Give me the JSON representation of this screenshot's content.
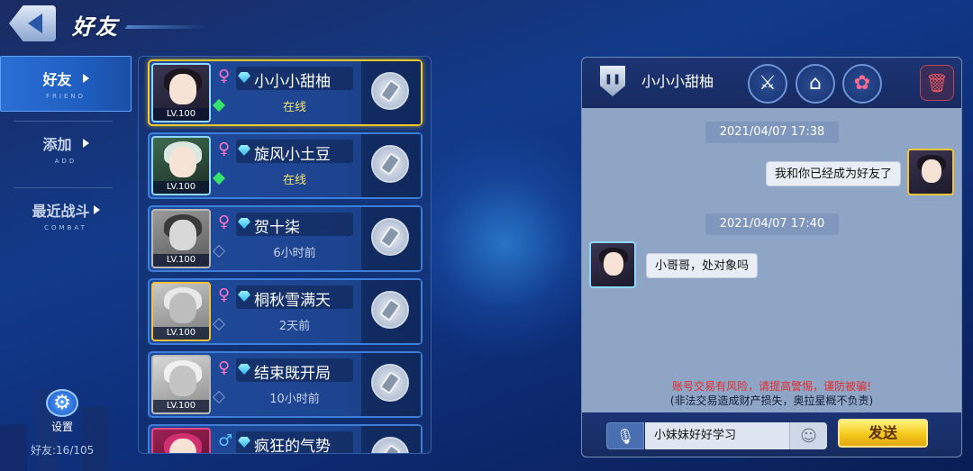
{
  "header": {
    "title": "好友"
  },
  "sidebar": {
    "items": [
      {
        "label": "好友",
        "sub": "FRIEND",
        "active": true
      },
      {
        "label": "添加",
        "sub": "ADD",
        "active": false
      },
      {
        "label": "最近战斗",
        "sub": "COMBAT",
        "active": false
      }
    ],
    "settings_label": "设置",
    "friend_count": "好友:16/105"
  },
  "friends": [
    {
      "gender": "♀",
      "name": "小小小甜柚",
      "level": "LV.100",
      "status": "在线",
      "online": true,
      "selected": true
    },
    {
      "gender": "♀",
      "name": "旋风小土豆",
      "level": "LV.100",
      "status": "在线",
      "online": true
    },
    {
      "gender": "♀",
      "name": "贺十柒",
      "level": "LV.100",
      "status": "6小时前",
      "online": false
    },
    {
      "gender": "♀",
      "name": "桐秋雪满天",
      "level": "LV.100",
      "status": "2天前",
      "online": false
    },
    {
      "gender": "♀",
      "name": "结束既开局",
      "level": "LV.100",
      "status": "10小时前",
      "online": false
    },
    {
      "gender": "♂",
      "name": "疯狂的气势",
      "level": "",
      "status": "",
      "online": false
    }
  ],
  "chat": {
    "partner_name": "小小小甜柚",
    "messages": [
      {
        "timestamp": "2021/04/07 17:38"
      },
      {
        "text": "我和你已经成为好友了",
        "side": "right"
      },
      {
        "timestamp": "2021/04/07 17:40"
      },
      {
        "text": "小哥哥，处对象吗",
        "side": "left"
      }
    ],
    "warning_line1": "账号交易有风险，请提高警惕，谨防被骗!",
    "warning_line2": "(非法交易造成财产损失，奥拉星概不负责)",
    "input_value": "小妹妹好好学习",
    "send_label": "发送"
  },
  "icons": {
    "back": "back-arrow-icon",
    "settings": "gear-icon",
    "action": "gift-chip-icon",
    "battle": "crossed-swords-icon",
    "home": "house-icon",
    "flower": "flower-icon",
    "trash": "trash-icon",
    "mic": "mic-icon",
    "emoji": "emoji-icon"
  },
  "colors": {
    "selected_border": "#f5c92a",
    "online": "#37e36a",
    "warning": "#e52d2d",
    "send_button": "#f5c81d"
  }
}
